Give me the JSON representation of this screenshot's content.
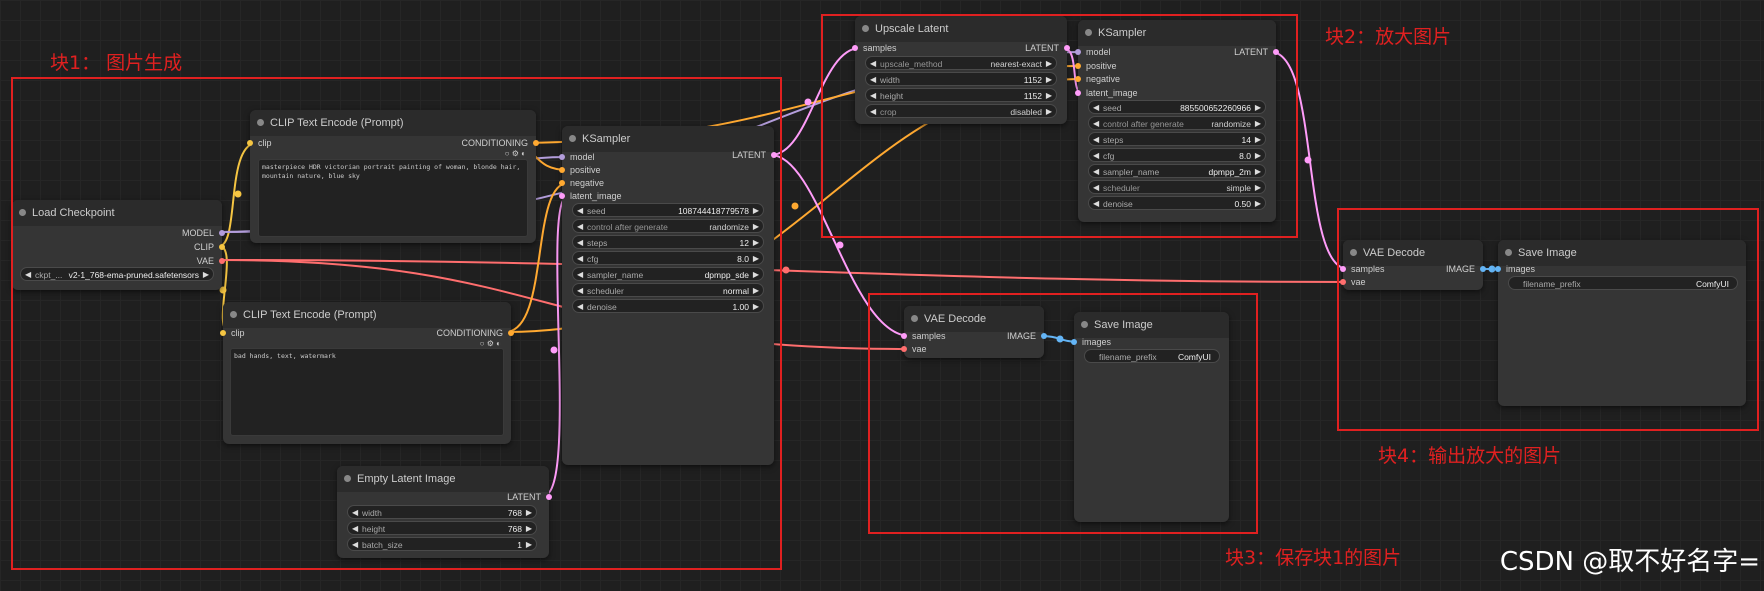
{
  "groups": {
    "g1": "块1： 图片生成",
    "g2": "块2：放大图片",
    "g3": "块3：保存块1的图片",
    "g4": "块4：输出放大的图片"
  },
  "watermark": "CSDN @取不好名字=",
  "colors": {
    "group_border": "#e02020",
    "model": "#b39ddb",
    "clip": "#f5c542",
    "vae": "#ff6e6e",
    "conditioning": "#ffa931",
    "latent": "#ff9cf9",
    "image": "#64b5f6"
  },
  "icons": {
    "prev": "◀",
    "next": "▶",
    "circle": "○",
    "gear": "⚙",
    "half": "◐"
  },
  "nodes": {
    "load_checkpoint": {
      "title": "Load Checkpoint",
      "outputs": [
        "MODEL",
        "CLIP",
        "VAE"
      ],
      "ckpt_label": "ckpt_...",
      "ckpt_value": "v2-1_768-ema-pruned.safetensors"
    },
    "clip_pos": {
      "title": "CLIP Text Encode (Prompt)",
      "input": "clip",
      "output": "CONDITIONING",
      "text": "masterpiece HDR victorian portrait painting of woman, blonde hair, mountain nature, blue sky"
    },
    "clip_neg": {
      "title": "CLIP Text Encode (Prompt)",
      "input": "clip",
      "output": "CONDITIONING",
      "text": "bad hands, text, watermark"
    },
    "empty_latent": {
      "title": "Empty Latent Image",
      "output": "LATENT",
      "widgets": [
        {
          "label": "width",
          "value": "768"
        },
        {
          "label": "height",
          "value": "768"
        },
        {
          "label": "batch_size",
          "value": "1"
        }
      ]
    },
    "ksampler1": {
      "title": "KSampler",
      "inputs": [
        "model",
        "positive",
        "negative",
        "latent_image"
      ],
      "output": "LATENT",
      "widgets": [
        {
          "label": "seed",
          "value": "108744418779578"
        },
        {
          "label": "control after generate",
          "value": "randomize"
        },
        {
          "label": "steps",
          "value": "12"
        },
        {
          "label": "cfg",
          "value": "8.0"
        },
        {
          "label": "sampler_name",
          "value": "dpmpp_sde"
        },
        {
          "label": "scheduler",
          "value": "normal"
        },
        {
          "label": "denoise",
          "value": "1.00"
        }
      ]
    },
    "upscale": {
      "title": "Upscale Latent",
      "input": "samples",
      "output": "LATENT",
      "widgets": [
        {
          "label": "upscale_method",
          "value": "nearest-exact"
        },
        {
          "label": "width",
          "value": "1152"
        },
        {
          "label": "height",
          "value": "1152"
        },
        {
          "label": "crop",
          "value": "disabled"
        }
      ]
    },
    "ksampler2": {
      "title": "KSampler",
      "inputs": [
        "model",
        "positive",
        "negative",
        "latent_image"
      ],
      "output": "LATENT",
      "widgets": [
        {
          "label": "seed",
          "value": "885500652260966"
        },
        {
          "label": "control after generate",
          "value": "randomize"
        },
        {
          "label": "steps",
          "value": "14"
        },
        {
          "label": "cfg",
          "value": "8.0"
        },
        {
          "label": "sampler_name",
          "value": "dpmpp_2m"
        },
        {
          "label": "scheduler",
          "value": "simple"
        },
        {
          "label": "denoise",
          "value": "0.50"
        }
      ]
    },
    "vae_decode1": {
      "title": "VAE Decode",
      "inputs": [
        "samples",
        "vae"
      ],
      "output": "IMAGE"
    },
    "save1": {
      "title": "Save Image",
      "input": "images",
      "widget": {
        "label": "filename_prefix",
        "value": "ComfyUI"
      }
    },
    "vae_decode2": {
      "title": "VAE Decode",
      "inputs": [
        "samples",
        "vae"
      ],
      "output": "IMAGE"
    },
    "save2": {
      "title": "Save Image",
      "input": "images",
      "widget": {
        "label": "filename_prefix",
        "value": "ComfyUI"
      }
    }
  }
}
